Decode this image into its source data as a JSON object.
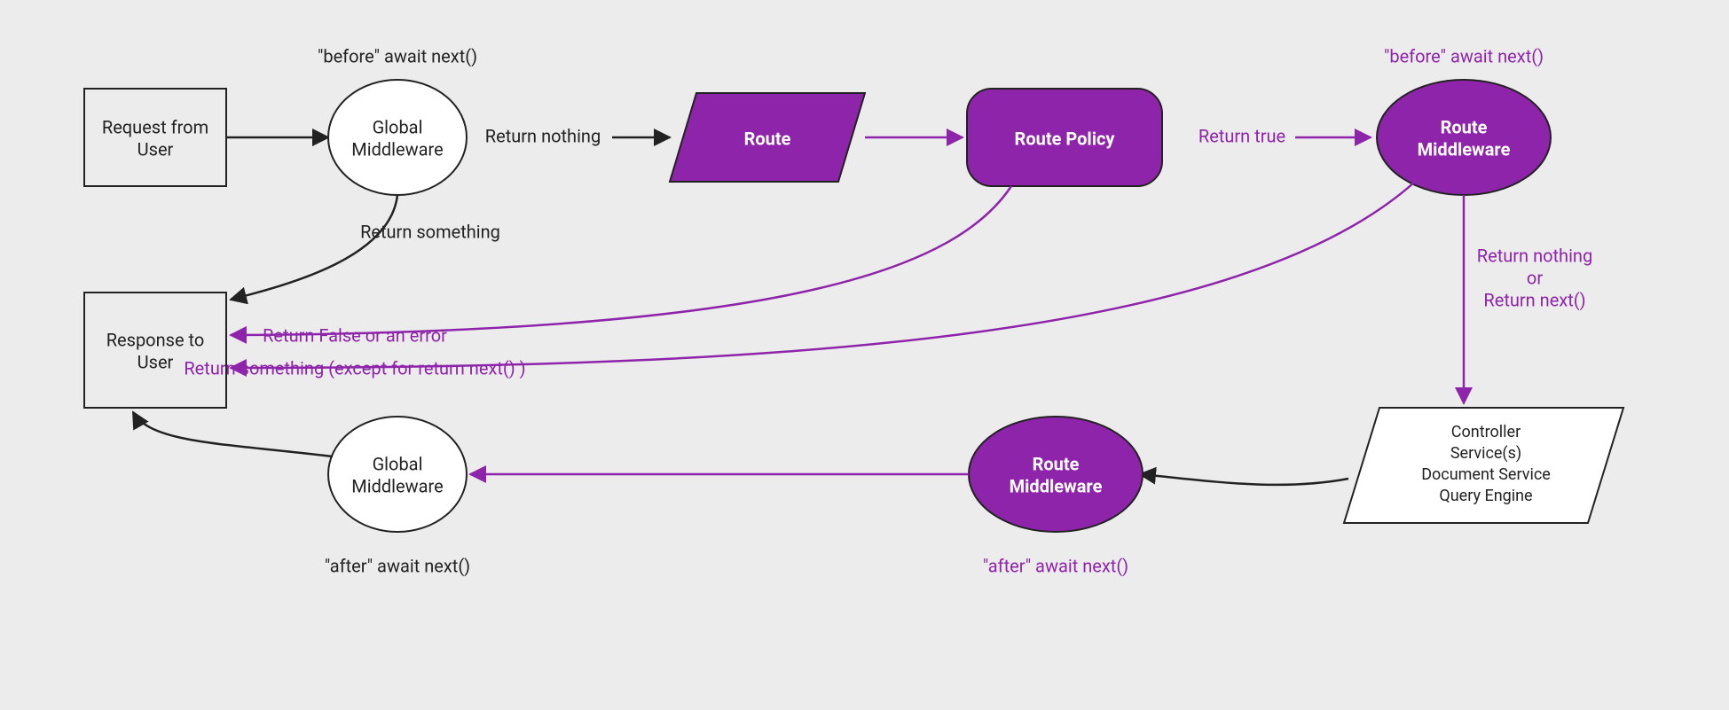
{
  "colors": {
    "purple": "#8e24aa",
    "stroke": "#222",
    "bg": "#ececec"
  },
  "nodes": {
    "request": {
      "line1": "Request from",
      "line2": "User"
    },
    "global_mw_1": {
      "line1": "Global",
      "line2": "Middleware",
      "caption": "\"before\" await next()"
    },
    "route": {
      "label": "Route"
    },
    "route_policy": {
      "label": "Route Policy"
    },
    "route_mw_1": {
      "line1": "Route",
      "line2": "Middleware",
      "caption": "\"before\" await next()"
    },
    "controllers": {
      "line1": "Controller",
      "line2": "Service(s)",
      "line3": "Document Service",
      "line4": "Query Engine"
    },
    "route_mw_2": {
      "line1": "Route",
      "line2": "Middleware",
      "caption": "\"after\" await next()"
    },
    "global_mw_2": {
      "line1": "Global",
      "line2": "Middleware",
      "caption": "\"after\" await next()"
    },
    "response": {
      "line1": "Response to",
      "line2": "User"
    }
  },
  "edges": {
    "gm_to_route": "Return nothing",
    "gm_to_response": "Return something",
    "policy_to_rmw": "Return true",
    "rmw_down_1": "Return nothing",
    "rmw_down_2": "or",
    "rmw_down_3": "Return next()",
    "policy_to_response": "Return False or an error",
    "rmw_to_response": "Return something (except for return next() )"
  }
}
